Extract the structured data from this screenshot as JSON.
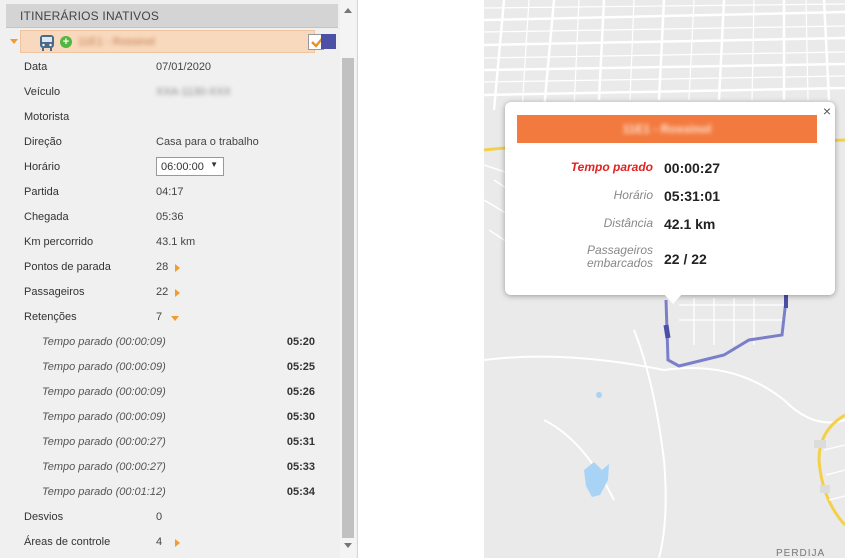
{
  "panel": {
    "header": "ITINERÁRIOS INATIVOS",
    "itinerary_name": "11E1 - Rossinol",
    "fields": {
      "data_label": "Data",
      "data_value": "07/01/2020",
      "veiculo_label": "Veículo",
      "veiculo_value": "XXA-1130-XXX",
      "motorista_label": "Motorista",
      "direcao_label": "Direção",
      "direcao_value": "Casa para o trabalho",
      "horario_label": "Horário",
      "horario_value": "06:00:00",
      "partida_label": "Partida",
      "partida_value": "04:17",
      "chegada_label": "Chegada",
      "chegada_value": "05:36",
      "km_label": "Km percorrido",
      "km_value": "43.1 km",
      "pontos_label": "Pontos de parada",
      "pontos_value": "28",
      "passageiros_label": "Passageiros",
      "passageiros_value": "22",
      "retencoes_label": "Retenções",
      "retencoes_value": "7",
      "desvios_label": "Desvios",
      "desvios_value": "0",
      "areas_label": "Áreas de controle",
      "areas_value": "4"
    },
    "retentions": [
      {
        "label": "Tempo parado (00:00:09)",
        "time": "05:20"
      },
      {
        "label": "Tempo parado (00:00:09)",
        "time": "05:25"
      },
      {
        "label": "Tempo parado (00:00:09)",
        "time": "05:26"
      },
      {
        "label": "Tempo parado (00:00:09)",
        "time": "05:30"
      },
      {
        "label": "Tempo parado (00:00:27)",
        "time": "05:31"
      },
      {
        "label": "Tempo parado (00:00:27)",
        "time": "05:33"
      },
      {
        "label": "Tempo parado (00:01:12)",
        "time": "05:34"
      }
    ],
    "colors": {
      "accent": "#f39c2c",
      "route_swatch": "#4b4fa6",
      "row_highlight": "#f9d9bd"
    }
  },
  "popup": {
    "title": "11E1 - Rossinol",
    "close": "×",
    "rows": [
      {
        "label": "Tempo parado",
        "value": "00:00:27"
      },
      {
        "label": "Horário",
        "value": "05:31:01"
      },
      {
        "label": "Distância",
        "value": "42.1 km"
      },
      {
        "label": "Passageiros embarcados",
        "value": "22 / 22"
      }
    ],
    "colors": {
      "title_bar": "#f37a3f",
      "alert_label": "#e22222"
    }
  },
  "map": {
    "labels": {
      "bottom_right": "PERDIJA"
    },
    "colors": {
      "route": "#7b7fc9",
      "road_yellow": "#f4d04a",
      "water": "#a9d3f5"
    }
  }
}
